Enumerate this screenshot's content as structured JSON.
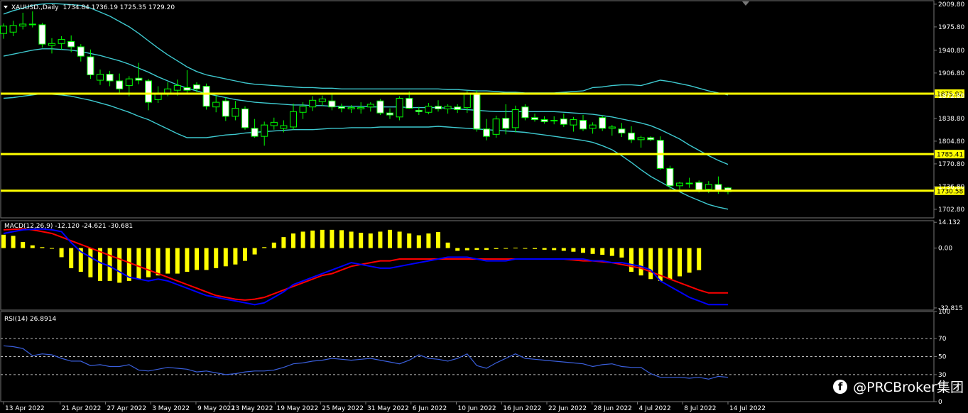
{
  "header": {
    "symbol_label": "XAUUSD.,Daily",
    "ohlc": "1734.84 1736.19 1725.35 1729.20"
  },
  "watermark": {
    "text": "@PRCBroker集团",
    "icon": "facebook-icon"
  },
  "colors": {
    "background": "#000000",
    "grid": "#777777",
    "bull_body": "#000000",
    "bear_body": "#ffffff",
    "wick": "#00ff00",
    "bollinger": "#3ec9cf",
    "horizontal_line": "#ffff00",
    "macd_hist": "#ffff00",
    "macd_line": "#0000ff",
    "signal_line": "#ff0000",
    "rsi_line": "#3a5fdc"
  },
  "chart_data": [
    {
      "type": "candlestick",
      "panel": "price",
      "ylim": [
        1690,
        2015
      ],
      "y_ticks": [
        "2009.80",
        "1975.80",
        "1940.80",
        "1906.80",
        "1872.80",
        "1838.80",
        "1804.80",
        "1770.80",
        "1736.80",
        "1702.80"
      ],
      "x_ticks": [
        "13 Apr 2022",
        "21 Apr 2022",
        "27 Apr 2022",
        "3 May 2022",
        "9 May 2022",
        "13 May 2022",
        "19 May 2022",
        "25 May 2022",
        "31 May 2022",
        "6 Jun 2022",
        "10 Jun 2022",
        "16 Jun 2022",
        "22 Jun 2022",
        "28 Jun 2022",
        "4 Jul 2022",
        "8 Jul 2022",
        "14 Jul 2022"
      ],
      "candles": [
        {
          "o": 1966,
          "h": 1981,
          "l": 1958,
          "c": 1977
        },
        {
          "o": 1968,
          "h": 1985,
          "l": 1962,
          "c": 1978
        },
        {
          "o": 1977,
          "h": 1997,
          "l": 1972,
          "c": 1980
        },
        {
          "o": 1980,
          "h": 1999,
          "l": 1975,
          "c": 1979
        },
        {
          "o": 1979,
          "h": 1982,
          "l": 1945,
          "c": 1950
        },
        {
          "o": 1948,
          "h": 1959,
          "l": 1936,
          "c": 1951
        },
        {
          "o": 1951,
          "h": 1962,
          "l": 1942,
          "c": 1957
        },
        {
          "o": 1954,
          "h": 1963,
          "l": 1938,
          "c": 1946
        },
        {
          "o": 1946,
          "h": 1950,
          "l": 1924,
          "c": 1932
        },
        {
          "o": 1931,
          "h": 1942,
          "l": 1898,
          "c": 1904
        },
        {
          "o": 1896,
          "h": 1912,
          "l": 1889,
          "c": 1905
        },
        {
          "o": 1905,
          "h": 1910,
          "l": 1887,
          "c": 1895
        },
        {
          "o": 1895,
          "h": 1906,
          "l": 1877,
          "c": 1883
        },
        {
          "o": 1888,
          "h": 1902,
          "l": 1872,
          "c": 1898
        },
        {
          "o": 1899,
          "h": 1922,
          "l": 1890,
          "c": 1896
        },
        {
          "o": 1895,
          "h": 1898,
          "l": 1851,
          "c": 1863
        },
        {
          "o": 1867,
          "h": 1887,
          "l": 1862,
          "c": 1876
        },
        {
          "o": 1876,
          "h": 1893,
          "l": 1872,
          "c": 1883
        },
        {
          "o": 1881,
          "h": 1897,
          "l": 1873,
          "c": 1888
        },
        {
          "o": 1885,
          "h": 1911,
          "l": 1876,
          "c": 1881
        },
        {
          "o": 1889,
          "h": 1893,
          "l": 1878,
          "c": 1883
        },
        {
          "o": 1887,
          "h": 1891,
          "l": 1852,
          "c": 1857
        },
        {
          "o": 1856,
          "h": 1873,
          "l": 1848,
          "c": 1863
        },
        {
          "o": 1865,
          "h": 1870,
          "l": 1835,
          "c": 1842
        },
        {
          "o": 1842,
          "h": 1865,
          "l": 1836,
          "c": 1854
        },
        {
          "o": 1853,
          "h": 1857,
          "l": 1822,
          "c": 1825
        },
        {
          "o": 1824,
          "h": 1838,
          "l": 1810,
          "c": 1812
        },
        {
          "o": 1812,
          "h": 1834,
          "l": 1798,
          "c": 1829
        },
        {
          "o": 1828,
          "h": 1840,
          "l": 1822,
          "c": 1833
        },
        {
          "o": 1824,
          "h": 1836,
          "l": 1818,
          "c": 1828
        },
        {
          "o": 1826,
          "h": 1861,
          "l": 1822,
          "c": 1849
        },
        {
          "o": 1848,
          "h": 1863,
          "l": 1838,
          "c": 1857
        },
        {
          "o": 1856,
          "h": 1872,
          "l": 1850,
          "c": 1866
        },
        {
          "o": 1864,
          "h": 1873,
          "l": 1857,
          "c": 1868
        },
        {
          "o": 1865,
          "h": 1875,
          "l": 1851,
          "c": 1856
        },
        {
          "o": 1856,
          "h": 1861,
          "l": 1848,
          "c": 1854
        },
        {
          "o": 1853,
          "h": 1859,
          "l": 1847,
          "c": 1855
        },
        {
          "o": 1853,
          "h": 1863,
          "l": 1846,
          "c": 1855
        },
        {
          "o": 1856,
          "h": 1863,
          "l": 1849,
          "c": 1860
        },
        {
          "o": 1865,
          "h": 1868,
          "l": 1844,
          "c": 1847
        },
        {
          "o": 1847,
          "h": 1854,
          "l": 1838,
          "c": 1844
        },
        {
          "o": 1841,
          "h": 1872,
          "l": 1836,
          "c": 1869
        },
        {
          "o": 1869,
          "h": 1879,
          "l": 1853,
          "c": 1854
        },
        {
          "o": 1851,
          "h": 1856,
          "l": 1844,
          "c": 1849
        },
        {
          "o": 1848,
          "h": 1862,
          "l": 1845,
          "c": 1857
        },
        {
          "o": 1857,
          "h": 1866,
          "l": 1849,
          "c": 1853
        },
        {
          "o": 1853,
          "h": 1860,
          "l": 1846,
          "c": 1857
        },
        {
          "o": 1856,
          "h": 1860,
          "l": 1847,
          "c": 1852
        },
        {
          "o": 1855,
          "h": 1880,
          "l": 1847,
          "c": 1876
        },
        {
          "o": 1877,
          "h": 1881,
          "l": 1819,
          "c": 1823
        },
        {
          "o": 1823,
          "h": 1838,
          "l": 1806,
          "c": 1812
        },
        {
          "o": 1815,
          "h": 1843,
          "l": 1810,
          "c": 1838
        },
        {
          "o": 1839,
          "h": 1860,
          "l": 1815,
          "c": 1824
        },
        {
          "o": 1825,
          "h": 1858,
          "l": 1818,
          "c": 1852
        },
        {
          "o": 1856,
          "h": 1860,
          "l": 1836,
          "c": 1840
        },
        {
          "o": 1840,
          "h": 1846,
          "l": 1834,
          "c": 1837
        },
        {
          "o": 1837,
          "h": 1842,
          "l": 1831,
          "c": 1834
        },
        {
          "o": 1836,
          "h": 1842,
          "l": 1830,
          "c": 1835
        },
        {
          "o": 1838,
          "h": 1846,
          "l": 1826,
          "c": 1830
        },
        {
          "o": 1829,
          "h": 1841,
          "l": 1819,
          "c": 1837
        },
        {
          "o": 1836,
          "h": 1844,
          "l": 1820,
          "c": 1823
        },
        {
          "o": 1824,
          "h": 1833,
          "l": 1816,
          "c": 1829
        },
        {
          "o": 1840,
          "h": 1843,
          "l": 1820,
          "c": 1824
        },
        {
          "o": 1824,
          "h": 1829,
          "l": 1813,
          "c": 1826
        },
        {
          "o": 1823,
          "h": 1832,
          "l": 1811,
          "c": 1817
        },
        {
          "o": 1817,
          "h": 1827,
          "l": 1802,
          "c": 1807
        },
        {
          "o": 1807,
          "h": 1813,
          "l": 1795,
          "c": 1810
        },
        {
          "o": 1810,
          "h": 1812,
          "l": 1805,
          "c": 1807
        },
        {
          "o": 1806,
          "h": 1812,
          "l": 1762,
          "c": 1764
        },
        {
          "o": 1764,
          "h": 1768,
          "l": 1732,
          "c": 1738
        },
        {
          "o": 1738,
          "h": 1744,
          "l": 1732,
          "c": 1742
        },
        {
          "o": 1742,
          "h": 1750,
          "l": 1735,
          "c": 1742
        },
        {
          "o": 1743,
          "h": 1746,
          "l": 1728,
          "c": 1732
        },
        {
          "o": 1733,
          "h": 1745,
          "l": 1727,
          "c": 1740
        },
        {
          "o": 1740,
          "h": 1752,
          "l": 1726,
          "c": 1731
        },
        {
          "o": 1734.84,
          "h": 1736.19,
          "l": 1725.35,
          "c": 1729.2
        }
      ],
      "bollinger_upper": [
        1995,
        2000,
        2004,
        2008,
        2010,
        2011,
        2010,
        2009,
        2008,
        2004,
        1998,
        1992,
        1984,
        1976,
        1966,
        1955,
        1944,
        1934,
        1925,
        1916,
        1909,
        1904,
        1901,
        1898,
        1895,
        1892,
        1890,
        1889,
        1888,
        1887,
        1886,
        1885,
        1885,
        1884,
        1884,
        1883,
        1883,
        1883,
        1883,
        1883,
        1883,
        1883,
        1883,
        1883,
        1883,
        1883,
        1882,
        1882,
        1881,
        1880,
        1880,
        1879,
        1878,
        1878,
        1877,
        1877,
        1877,
        1877,
        1878,
        1879,
        1880,
        1885,
        1886,
        1888,
        1889,
        1889,
        1888,
        1892,
        1896,
        1894,
        1891,
        1888,
        1884,
        1880,
        1877,
        1874
      ],
      "bollinger_mid": [
        1932,
        1935,
        1938,
        1941,
        1943,
        1943,
        1942,
        1941,
        1939,
        1936,
        1933,
        1929,
        1925,
        1920,
        1914,
        1908,
        1901,
        1895,
        1889,
        1884,
        1880,
        1876,
        1873,
        1870,
        1867,
        1865,
        1863,
        1862,
        1861,
        1860,
        1859,
        1859,
        1858,
        1858,
        1857,
        1857,
        1857,
        1857,
        1856,
        1856,
        1856,
        1856,
        1855,
        1855,
        1855,
        1855,
        1854,
        1853,
        1852,
        1851,
        1850,
        1849,
        1849,
        1849,
        1849,
        1849,
        1849,
        1849,
        1848,
        1847,
        1846,
        1845,
        1843,
        1841,
        1838,
        1835,
        1832,
        1828,
        1822,
        1815,
        1808,
        1799,
        1791,
        1783,
        1776,
        1770
      ],
      "bollinger_lower": [
        1869,
        1870,
        1872,
        1874,
        1876,
        1875,
        1874,
        1872,
        1869,
        1866,
        1862,
        1858,
        1853,
        1848,
        1842,
        1837,
        1830,
        1823,
        1816,
        1810,
        1810,
        1810,
        1812,
        1814,
        1815,
        1817,
        1818,
        1819,
        1820,
        1821,
        1822,
        1822,
        1822,
        1823,
        1824,
        1824,
        1825,
        1825,
        1825,
        1826,
        1826,
        1826,
        1826,
        1826,
        1826,
        1827,
        1826,
        1825,
        1824,
        1823,
        1822,
        1821,
        1820,
        1819,
        1818,
        1816,
        1814,
        1812,
        1810,
        1808,
        1806,
        1803,
        1798,
        1792,
        1783,
        1773,
        1762,
        1752,
        1744,
        1736,
        1729,
        1722,
        1716,
        1710,
        1706,
        1703
      ],
      "hlines": [
        {
          "value": 1875.92,
          "label": "1875.92"
        },
        {
          "value": 1785.41,
          "label": "1785.41"
        },
        {
          "value": 1730.58,
          "label": "1730.58"
        }
      ]
    },
    {
      "type": "bar",
      "panel": "macd",
      "label": "MACD(12,26,9) -12.120 -24.621 -30.681",
      "ylim": [
        -34,
        15
      ],
      "y_ticks": [
        "14.132",
        "0.00",
        "-32.815"
      ],
      "histogram": [
        7.3,
        6.7,
        3.3,
        1.5,
        0.5,
        0,
        -5,
        -11,
        -13,
        -16,
        -18,
        -18,
        -19,
        -18,
        -17,
        -16,
        -15,
        -14,
        -14,
        -13,
        -12,
        -12,
        -11,
        -10,
        -9,
        -7,
        -3.5,
        0.5,
        3,
        6,
        8,
        9,
        9.6,
        10,
        10,
        9.8,
        9,
        8.4,
        8,
        9,
        10,
        9,
        8,
        7,
        8,
        8.8,
        3,
        -1.5,
        -1.2,
        -1,
        -1,
        -0.5,
        -0.2,
        0.2,
        -0.3,
        -0.5,
        -0.9,
        -1.1,
        -1.5,
        -2,
        -2.6,
        -3.2,
        -3.7,
        -4.3,
        -5.2,
        -13,
        -15,
        -17,
        -18,
        -17,
        -15.5,
        -13.5,
        -12.1
      ],
      "macd_line": [
        8,
        9,
        10,
        10.3,
        10.5,
        10,
        9,
        3,
        -2,
        -5,
        -8,
        -10,
        -13,
        -16,
        -17,
        -18,
        -17,
        -18,
        -20,
        -22,
        -24,
        -26,
        -27,
        -28,
        -29,
        -30,
        -31,
        -30,
        -27,
        -24,
        -20,
        -18,
        -16,
        -14,
        -12,
        -10,
        -8,
        -9,
        -10,
        -11,
        -11,
        -10,
        -9,
        -8,
        -7,
        -6,
        -5,
        -5,
        -5,
        -6,
        -7,
        -7,
        -7,
        -6,
        -6,
        -6,
        -6,
        -6,
        -6,
        -6,
        -6,
        -7,
        -7,
        -8,
        -8,
        -9,
        -10,
        -12,
        -18,
        -21,
        -24,
        -27,
        -29,
        -31,
        -31,
        -31
      ],
      "signal_line": [
        10,
        10.3,
        10.5,
        10,
        9,
        8,
        6,
        4,
        2,
        0,
        -2,
        -4,
        -6,
        -8,
        -10,
        -12,
        -14,
        -16,
        -18,
        -20,
        -22,
        -24,
        -26,
        -27,
        -28,
        -28.5,
        -28,
        -27,
        -25,
        -23,
        -21,
        -19,
        -17,
        -15,
        -14,
        -12,
        -10,
        -9,
        -8,
        -7,
        -7,
        -6,
        -6,
        -6,
        -6,
        -6,
        -6,
        -6,
        -6,
        -6,
        -6,
        -6,
        -6,
        -6,
        -6,
        -6,
        -6,
        -6,
        -6,
        -6.5,
        -7,
        -7,
        -7.5,
        -8,
        -9,
        -10,
        -11,
        -13,
        -15,
        -17,
        -19,
        -21,
        -23,
        -24.6,
        -24.6,
        -24.6
      ]
    },
    {
      "type": "line",
      "panel": "rsi",
      "label": "RSI(14) 26.8914",
      "ylim": [
        0,
        100
      ],
      "y_ticks": [
        "100",
        "70",
        "50",
        "30",
        "0"
      ],
      "levels": [
        70,
        50,
        30
      ],
      "values": [
        62,
        61,
        59,
        51,
        53,
        52,
        48,
        45,
        45,
        40,
        41,
        39,
        39,
        41,
        35,
        34,
        36,
        38,
        37,
        36,
        33,
        34,
        32,
        30,
        31,
        33,
        34,
        34,
        35,
        38,
        42,
        43,
        45,
        46,
        48,
        47,
        46,
        47,
        48,
        46,
        44,
        42,
        46,
        52,
        48,
        47,
        45,
        48,
        53,
        40,
        37,
        43,
        48,
        53,
        48,
        47,
        46,
        45,
        44,
        43,
        42,
        39,
        41,
        42,
        39,
        38,
        38,
        31,
        27,
        27,
        27,
        26,
        27,
        25,
        28,
        27
      ]
    }
  ]
}
